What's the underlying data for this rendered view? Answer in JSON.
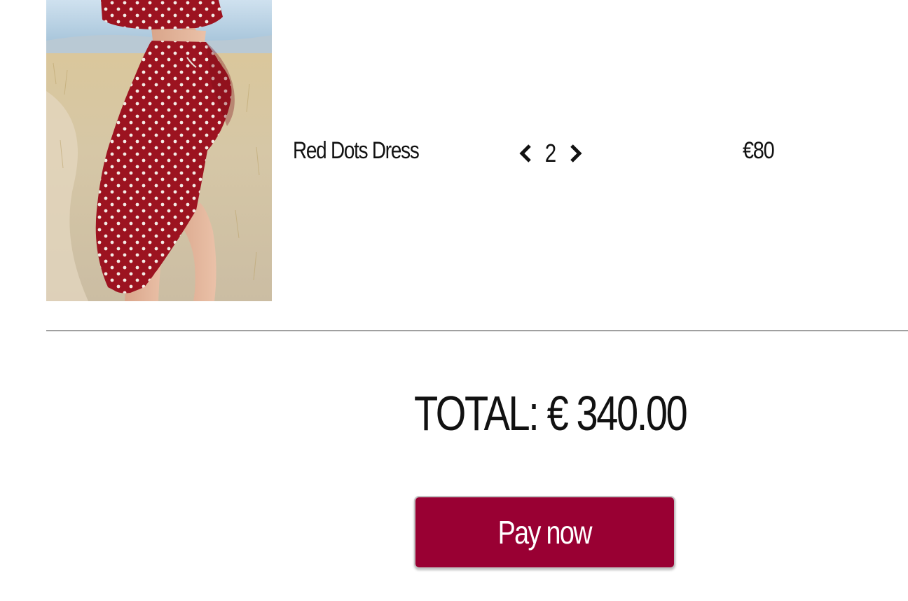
{
  "cart": {
    "item": {
      "image_alt": "Red Dots Dress",
      "name": "Red Dots Dress",
      "quantity": "2",
      "price": "€80"
    },
    "icons": {
      "decrease": "chevron-left-icon",
      "increase": "chevron-right-icon"
    }
  },
  "summary": {
    "total_label": "TOTAL: € 340.00",
    "pay_button_label": "Pay now"
  },
  "colors": {
    "accent": "#990033",
    "text": "#111111",
    "divider": "#a0a0a0"
  }
}
